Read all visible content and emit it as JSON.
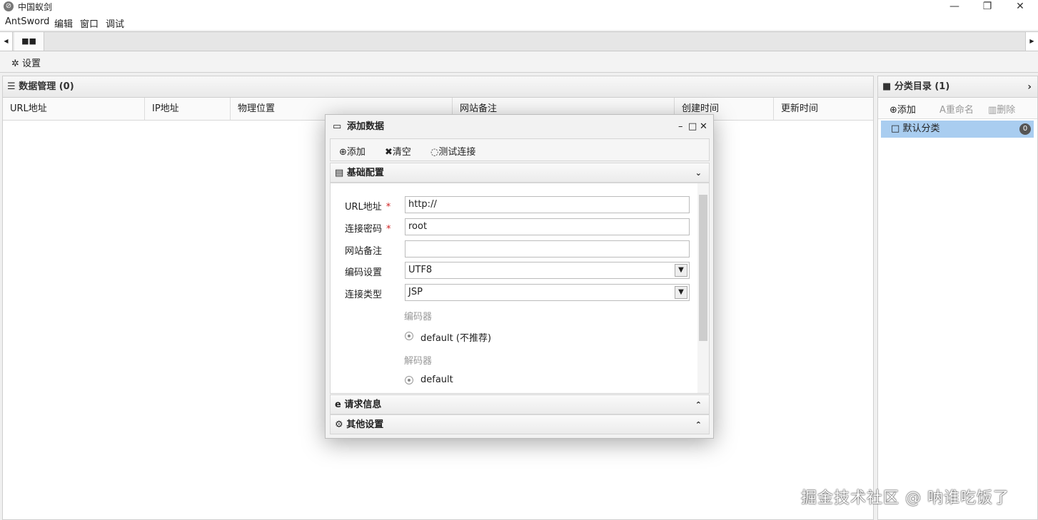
{
  "window": {
    "title": "中国蚁剑",
    "controls": {
      "minimize": "—",
      "restore": "❐",
      "close": "✕"
    }
  },
  "menu": [
    "AntSword",
    "编辑",
    "窗口",
    "调试"
  ],
  "tabs": {
    "left_arrow": "◀",
    "right_arrow": "▶",
    "home_tab_icon": "grid-icon"
  },
  "settings": {
    "label": "设置"
  },
  "data_panel": {
    "title": "数据管理 (0)",
    "columns": [
      "URL地址",
      "IP地址",
      "物理位置",
      "网站备注",
      "创建时间",
      "更新时间"
    ]
  },
  "category_panel": {
    "title": "分类目录 (1)",
    "tools": {
      "add": "添加",
      "rename": "重命名",
      "delete": "删除"
    },
    "items": [
      {
        "name": "默认分类",
        "count": "0"
      }
    ]
  },
  "dialog": {
    "title": "添加数据",
    "toolbar": {
      "add": "添加",
      "clear": "清空",
      "test": "测试连接"
    },
    "sections": {
      "basic": "基础配置",
      "request": "请求信息",
      "other": "其他设置"
    },
    "form": {
      "url_label": "URL地址",
      "url_value": "http://",
      "password_label": "连接密码",
      "password_value": "root",
      "note_label": "网站备注",
      "note_value": "",
      "encoding_label": "编码设置",
      "encoding_value": "UTF8",
      "type_label": "连接类型",
      "type_value": "JSP",
      "encoder_group": "编码器",
      "encoder_option": "default (不推荐)",
      "decoder_group": "解码器",
      "decoder_option": "default",
      "required_mark": "*"
    }
  },
  "watermark": "掘金技术社区 @ 呐谁吃饭了"
}
